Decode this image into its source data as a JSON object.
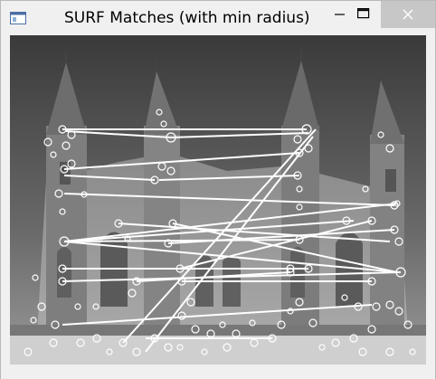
{
  "window": {
    "title": "SURF Matches (with min radius)",
    "accent": "#c7c7c7"
  },
  "icons": {
    "app": "app-window-icon",
    "minimize": "minimize-icon",
    "maximize": "maximize-icon",
    "close": "close-icon"
  }
}
